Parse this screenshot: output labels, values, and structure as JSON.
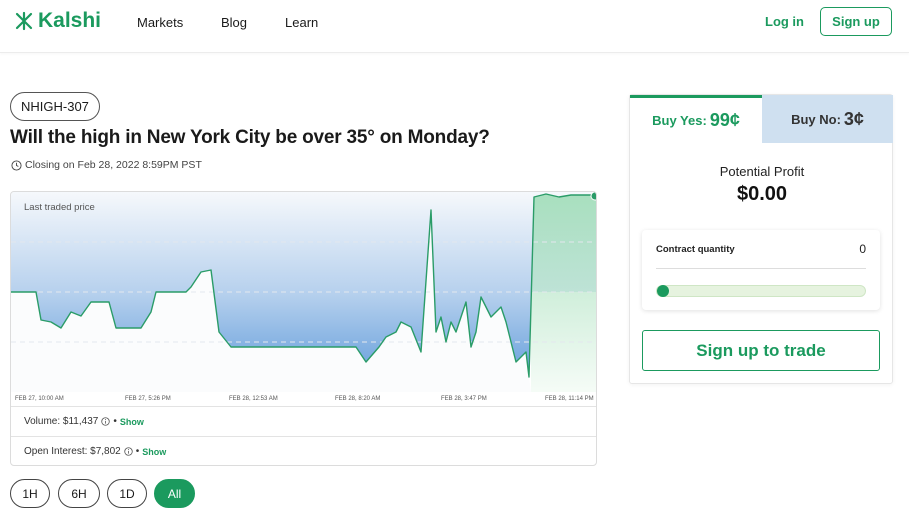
{
  "header": {
    "brand": "Kalshi",
    "nav": [
      {
        "label": "Markets"
      },
      {
        "label": "Blog"
      },
      {
        "label": "Learn"
      }
    ],
    "login_label": "Log in",
    "signup_label": "Sign up"
  },
  "market": {
    "ticker": "NHIGH-307",
    "title": "Will the high in New York City be over 35° on Monday?",
    "closing": "Closing on Feb 28, 2022 8:59PM PST"
  },
  "chart": {
    "label": "Last traded price",
    "x_ticks": [
      "FEB 27, 10:00 AM",
      "FEB 27, 5:26 PM",
      "FEB 28, 12:53 AM",
      "FEB 28, 8:20 AM",
      "FEB 28, 3:47 PM",
      "FEB 28, 11:14 PM"
    ],
    "colors": {
      "line": "#2a9c68",
      "fill_low": "#4d8fd6",
      "fill_high": "#7fd19e"
    }
  },
  "stats": {
    "volume": "Volume: $11,437",
    "open_interest": "Open Interest: $7,802",
    "show_label": "Show"
  },
  "ranges": [
    {
      "label": "1H",
      "active": false
    },
    {
      "label": "6H",
      "active": false
    },
    {
      "label": "1D",
      "active": false
    },
    {
      "label": "All",
      "active": true
    }
  ],
  "trade": {
    "buy_yes_label": "Buy Yes:",
    "buy_yes_price": "99¢",
    "buy_no_label": "Buy No:",
    "buy_no_price": "3¢",
    "potential_profit_label": "Potential Profit",
    "potential_profit_value": "$0.00",
    "contract_quantity_label": "Contract quantity",
    "contract_quantity_value": "0",
    "cta_label": "Sign up to trade"
  }
}
